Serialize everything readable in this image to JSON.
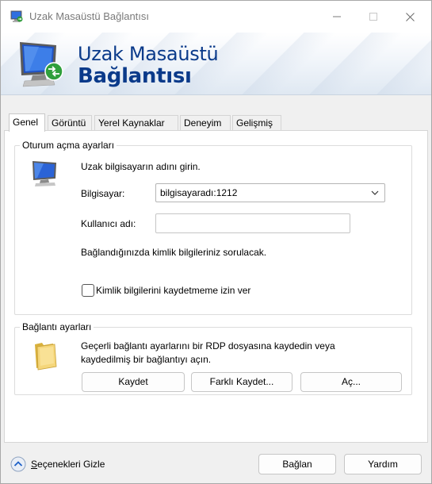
{
  "window": {
    "title": "Uzak Masaüstü Bağlantısı",
    "controls": {
      "minimize": "minimize",
      "maximize": "maximize",
      "close": "close"
    }
  },
  "banner": {
    "line1": "Uzak Masaüstü",
    "line2": "Bağlantısı"
  },
  "tabs": [
    {
      "label": "Genel",
      "active": true
    },
    {
      "label": "Görüntü",
      "active": false
    },
    {
      "label": "Yerel Kaynaklar",
      "active": false
    },
    {
      "label": "Deneyim",
      "active": false
    },
    {
      "label": "Gelişmiş",
      "active": false
    }
  ],
  "logon": {
    "group_label": "Oturum açma ayarları",
    "instruction": "Uzak bilgisayarın adını girin.",
    "computer_label": "Bilgisayar:",
    "computer_value": "bilgisayaradı:1212",
    "username_label": "Kullanıcı adı:",
    "username_value": "",
    "credentials_note": "Bağlandığınızda kimlik bilgileriniz sorulacak.",
    "allow_save_label": "Kimlik bilgilerini kaydetmeme izin ver",
    "allow_save_checked": false
  },
  "connection": {
    "group_label": "Bağlantı ayarları",
    "description_line1": "Geçerli bağlantı ayarlarını bir RDP dosyasına kaydedin veya",
    "description_line2": "kaydedilmiş bir bağlantıyı açın.",
    "save_label": "Kaydet",
    "save_as_label": "Farklı Kaydet...",
    "open_label": "Aç..."
  },
  "footer": {
    "options_label_prefix": "S",
    "options_label_rest": "eçenekleri Gizle",
    "connect_label": "Bağlan",
    "help_label": "Yardım"
  },
  "colors": {
    "banner_text": "#0a3a8a",
    "accent": "#1e60c8"
  }
}
